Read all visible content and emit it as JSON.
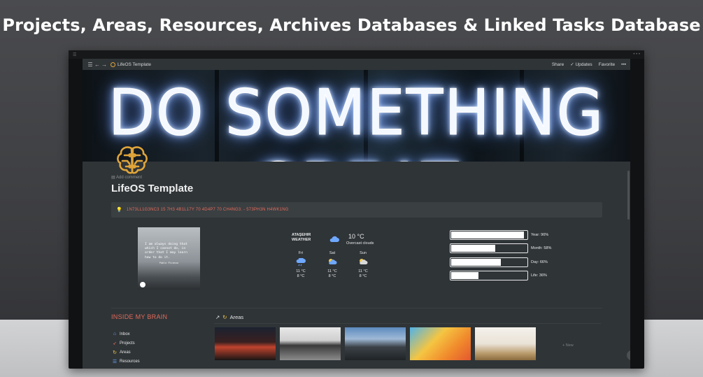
{
  "headline": "Projects, Areas, Resources, Archives Databases & Linked Tasks Database",
  "topbar": {
    "page_name": "LifeOS Template",
    "share": "Share",
    "updates": "Updates",
    "favorite": "Favorite",
    "more": "•••"
  },
  "cover": {
    "text": "DO SOMETHING GREAT"
  },
  "page": {
    "add_comment": "Add comment",
    "title": "LifeOS Template",
    "callout": "1N73LL1G3NC3 15 7H3 4B1L17Y 70 4D4P7 70 CH4NG3. - 573PH3N H4WK1NG"
  },
  "quote": {
    "text": "I am always doing that which I cannot do, in order that I may learn how to do it.",
    "author": "Pablo Picasso"
  },
  "weather": {
    "city": "ATAŞEHIR",
    "label": "WEATHER",
    "current_temp": "10 °C",
    "current_desc": "Overcast clouds",
    "days": [
      {
        "name": "Fri",
        "high": "11 °C",
        "low": "8 °C",
        "icon": "rain-cloud-icon"
      },
      {
        "name": "Sat",
        "high": "11 °C",
        "low": "8 °C",
        "icon": "sun-cloud-rain-icon"
      },
      {
        "name": "Sun",
        "high": "11 °C",
        "low": "8 °C",
        "icon": "sun-cloud-icon"
      }
    ]
  },
  "progress": [
    {
      "label": "Year: 96%",
      "value": 0.96
    },
    {
      "label": "Month: 58%",
      "value": 0.58
    },
    {
      "label": "Day: 66%",
      "value": 0.66
    },
    {
      "label": "Life: 36%",
      "value": 0.36
    }
  ],
  "brain": {
    "title": "INSIDE MY BRAIN",
    "items": [
      {
        "label": "Inbox",
        "icon": "inbox-icon"
      },
      {
        "label": "Projects",
        "icon": "rocket-icon"
      },
      {
        "label": "Areas",
        "icon": "refresh-icon"
      },
      {
        "label": "Resources",
        "icon": "list-icon"
      }
    ]
  },
  "areas": {
    "title": "Areas",
    "new_label": "+ New"
  },
  "help": "?",
  "colors": {
    "accent_red": "#e36a5a",
    "brain_gold": "#e0a53a",
    "background": "#2f3437"
  }
}
